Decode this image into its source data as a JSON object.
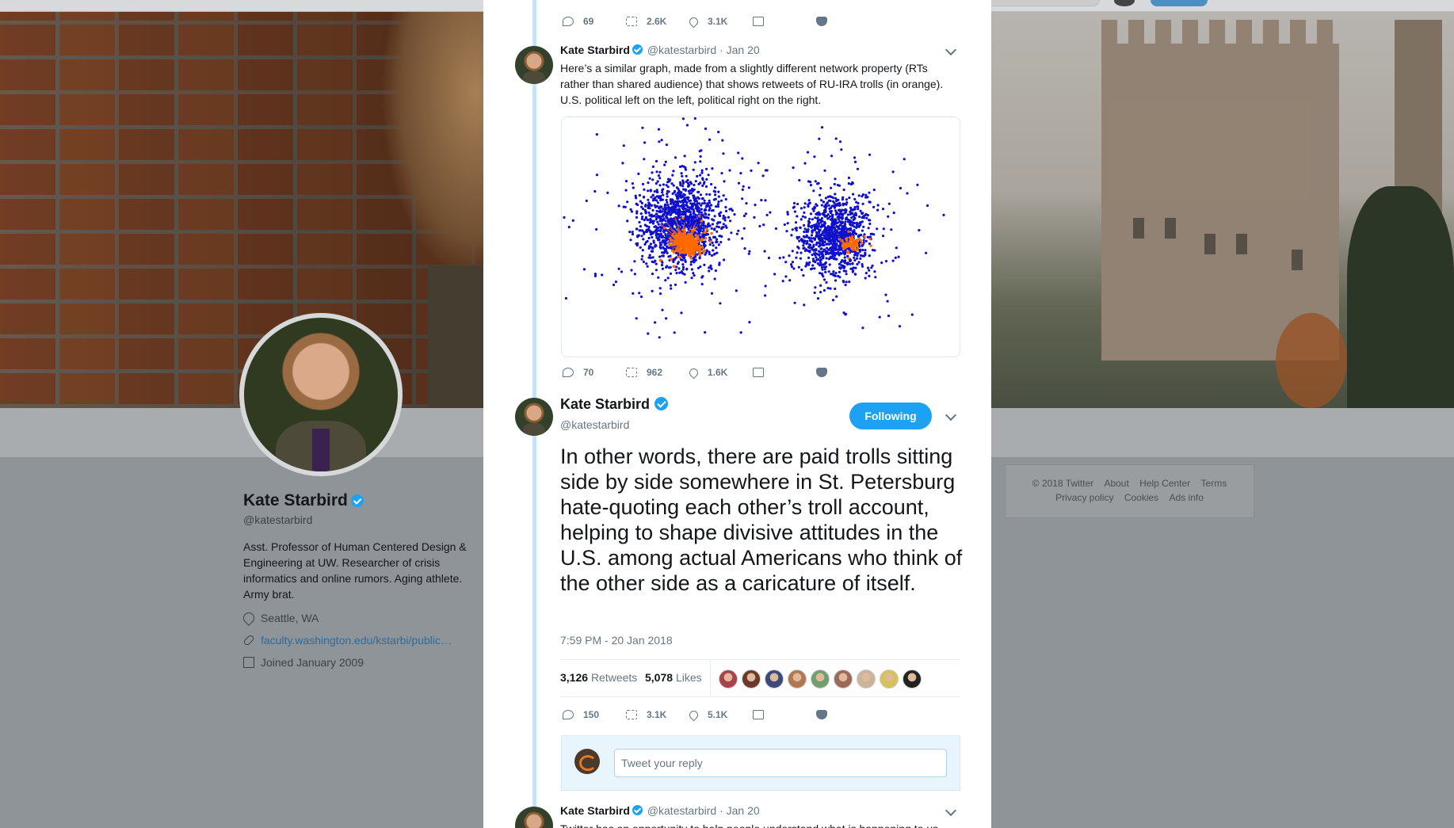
{
  "profile": {
    "name": "Kate Starbird",
    "handle": "@katestarbird",
    "bio": "Asst. Professor of Human Centered Design & Engineering at UW. Researcher of crisis informatics and online rumors. Aging athlete. Army brat.",
    "location": "Seattle, WA",
    "website": "faculty.washington.edu/kstarbi/public…",
    "joined": "Joined January 2009"
  },
  "footer": {
    "row1": [
      "© 2018 Twitter",
      "About",
      "Help Center",
      "Terms"
    ],
    "row2": [
      "Privacy policy",
      "Cookies",
      "Ads info"
    ]
  },
  "top_actions": {
    "replies": "69",
    "retweets": "2.6K",
    "likes": "3.1K"
  },
  "tweet1": {
    "name": "Kate Starbird",
    "handle": "@katestarbird",
    "date": "· Jan 20",
    "text": "Here’s a similar graph, made from a slightly different network property (RTs rather than shared audience) that shows retweets of RU-IRA trolls (in orange). U.S. political left on the left, political right on the right.",
    "replies": "70",
    "retweets": "962",
    "likes": "1.6K"
  },
  "main_tweet": {
    "name": "Kate Starbird",
    "handle": "@katestarbird",
    "follow_label": "Following",
    "text": "In other words, there are paid trolls sitting side by side somewhere in St. Petersburg hate-quoting each other’s troll account, helping to shape divisive attitudes in the U.S. among actual Americans who think of the other side as a caricature of itself.",
    "timestamp": "7:59 PM - 20 Jan 2018",
    "retweet_count": "3,126",
    "retweet_label": "Retweets",
    "like_count": "5,078",
    "like_label": "Likes",
    "replies": "150",
    "retweets": "3.1K",
    "likes": "5.1K",
    "face_colors": [
      "#a8424c",
      "#6b3a2a",
      "#3b4a78",
      "#b07850",
      "#6f9f6f",
      "#9c6a5a",
      "#c9b49c",
      "#d6c25a",
      "#222222"
    ]
  },
  "reply": {
    "placeholder": "Tweet your reply"
  },
  "tweet3": {
    "name": "Kate Starbird",
    "handle": "@katestarbird",
    "date": "· Jan 20",
    "text": "Twitter has an opportunity to help people understand what is happening to us -"
  },
  "colors": {
    "accent": "#1da1f2",
    "troll_orange": "#ff6a00",
    "network_blue": "#1010cc"
  },
  "icons": [
    "reply-icon",
    "retweet-icon",
    "like-icon",
    "dm-icon",
    "pocket-icon",
    "caret-icon",
    "verified-icon",
    "location-icon",
    "link-icon",
    "calendar-icon"
  ]
}
